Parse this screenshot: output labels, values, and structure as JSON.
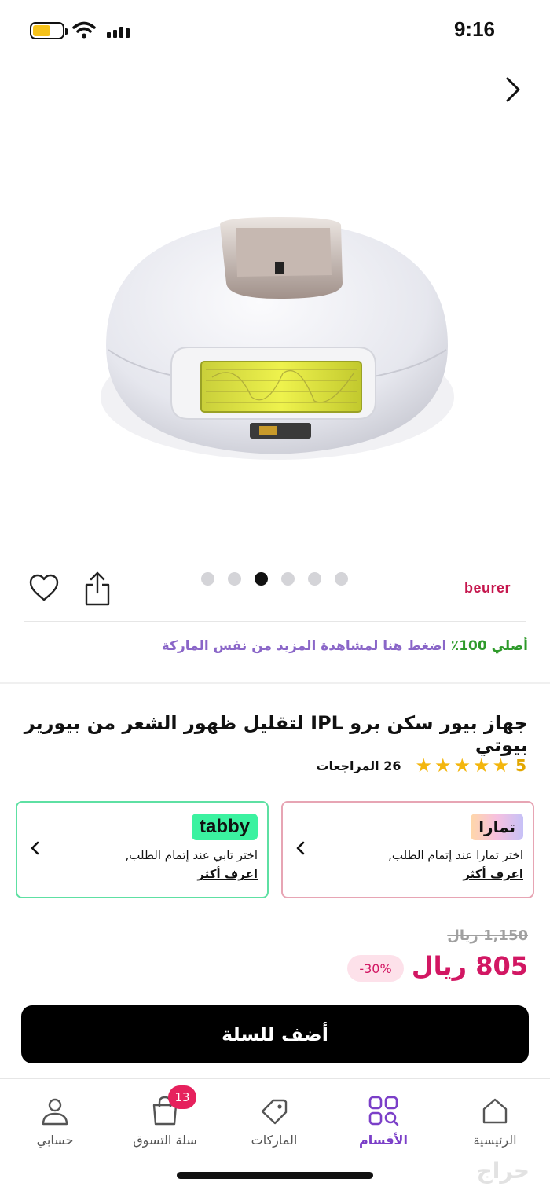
{
  "status_bar": {
    "time": "9:16"
  },
  "gallery": {
    "dot_count": 6,
    "active_dot": 3
  },
  "brand": {
    "name": "beurer",
    "color": "#c5164d"
  },
  "authenticity": {
    "prefix": "أصلي 100٪",
    "link": "اضغط هنا لمشاهدة المزيد من نفس الماركة"
  },
  "product": {
    "title": "جهاز بيور سكن برو IPL لتقليل ظهور الشعر من بيورير بيوتي",
    "rating": "5",
    "stars": 5,
    "reviews": "26 المراجعات"
  },
  "bnpl": {
    "tamara": {
      "badge": "تمارا",
      "line1": "اختر تمارا عند إتمام الطلب,",
      "link": "اعرف أكثر"
    },
    "tabby": {
      "badge": "tabby",
      "line1": "اختر تابي عند إتمام الطلب,",
      "link": "اعرف أكثر"
    }
  },
  "pricing": {
    "old_price": "1,150 ريال",
    "price": "805 ريال",
    "discount": "-30%"
  },
  "cart_button": {
    "label": "أضف للسلة"
  },
  "tabbar": {
    "home": "الرئيسية",
    "categories": "الأقسام",
    "brands": "الماركات",
    "cart": "سلة التسوق",
    "cart_count": "13",
    "account": "حسابي"
  },
  "colors": {
    "accent": "#7b3fc8",
    "price": "#d21763",
    "green": "#2e9a2a"
  },
  "watermark": "حراج"
}
